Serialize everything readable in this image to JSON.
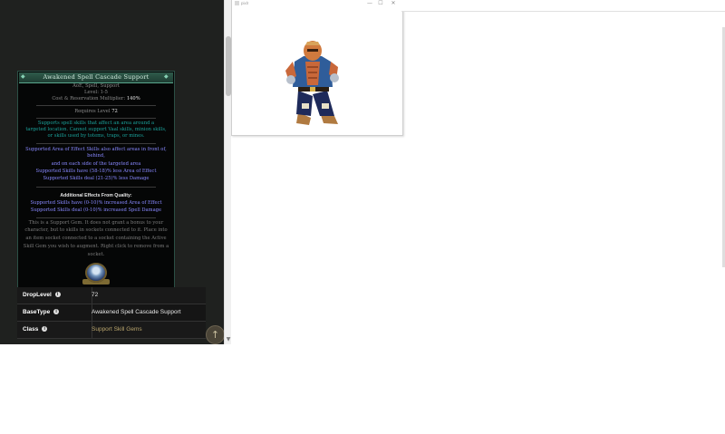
{
  "gem": {
    "title": "Awakened Spell Cascade Support",
    "tags": "AoE, Spell, Support",
    "level": "Level: 1-5",
    "multiplier_label": "Cost & Reservation Multiplier:",
    "multiplier_value": "140%",
    "requires": "Requires Level",
    "requires_value": "72",
    "desc_1": "Supports spell skills that affect an area around a",
    "desc_2": "targeted location. Cannot support Vaal skills, minion skills,",
    "desc_3": "or skills used by totems, traps, or mines.",
    "mod_1": "Supported Area of Effect Skills also affect areas in front of,",
    "mod_2": "behind,",
    "mod_3": "and on each side of the targeted area",
    "mod_4": "Supported Skills have (58-18)% less Area of Effect",
    "mod_5": "Supported Skills deal (21-25)% less Damage",
    "quality_header": "Additional Effects From Quality:",
    "quality_1": "Supported Skills have (0-10)% increased Area of Effect",
    "quality_2": "Supported Skills deal (0-10)% increased Spell Damage",
    "help_1": "This is a Support Gem. It does not grant a bonus to your",
    "help_2": "character, but to skills in sockets connected to it. Place into",
    "help_3": "an item socket connected to a socket containing the Active",
    "help_4": "Skill Gem you wish to augment. Right click to remove from a",
    "help_5": "socket."
  },
  "table": {
    "rows": [
      {
        "key": "DropLevel",
        "value": "72"
      },
      {
        "key": "BaseType",
        "value": "Awakened Spell Cascade Support"
      },
      {
        "key": "Class",
        "value": "Support Skill Gems"
      }
    ]
  },
  "app": {
    "title": "pixlr",
    "minimize": "—",
    "maximize": "☐",
    "close": "✕"
  },
  "icons": {
    "info": "i",
    "back_to_top": "↑",
    "scroll_down": "▼"
  }
}
